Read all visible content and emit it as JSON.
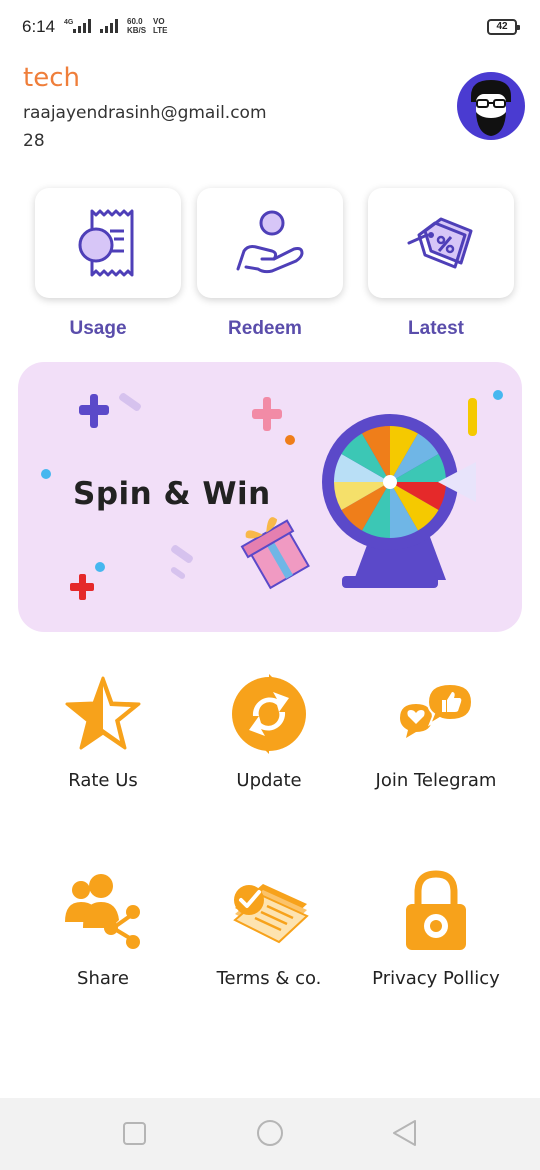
{
  "status_bar": {
    "time": "6:14",
    "network_type": "4G",
    "speed_value": "60.0",
    "speed_unit": "KB/S",
    "volte_top": "VO",
    "volte_bottom": "LTE",
    "battery_level": "42"
  },
  "profile": {
    "name": "tech",
    "email": "raajayendrasinh@gmail.com",
    "age": "28"
  },
  "quick_actions": [
    {
      "label": "Usage",
      "icon": "receipt-coin-icon"
    },
    {
      "label": "Redeem",
      "icon": "hand-coin-icon"
    },
    {
      "label": "Latest",
      "icon": "discount-tag-icon"
    }
  ],
  "banner": {
    "title": "Spin & Win",
    "icon": "prize-wheel-icon"
  },
  "grid": [
    {
      "label": "Rate Us",
      "icon": "star-icon"
    },
    {
      "label": "Update",
      "icon": "refresh-icon"
    },
    {
      "label": "Join Telegram",
      "icon": "chat-bubbles-icon"
    },
    {
      "label": "Share",
      "icon": "share-users-icon"
    },
    {
      "label": "Terms & co.",
      "icon": "document-check-icon"
    },
    {
      "label": "Privacy Pollicy",
      "icon": "padlock-icon"
    }
  ],
  "nav_bar": {
    "recents_icon": "square-icon",
    "home_icon": "circle-icon",
    "back_icon": "triangle-back-icon"
  },
  "colors": {
    "accent_orange": "#ef7e3a",
    "icon_orange": "#f7a21b",
    "quick_label_purple": "#5a4dab",
    "icon_purple": "#4e3fb8",
    "banner_bg": "#f2dff8",
    "avatar_bg": "#4a3bd1"
  }
}
